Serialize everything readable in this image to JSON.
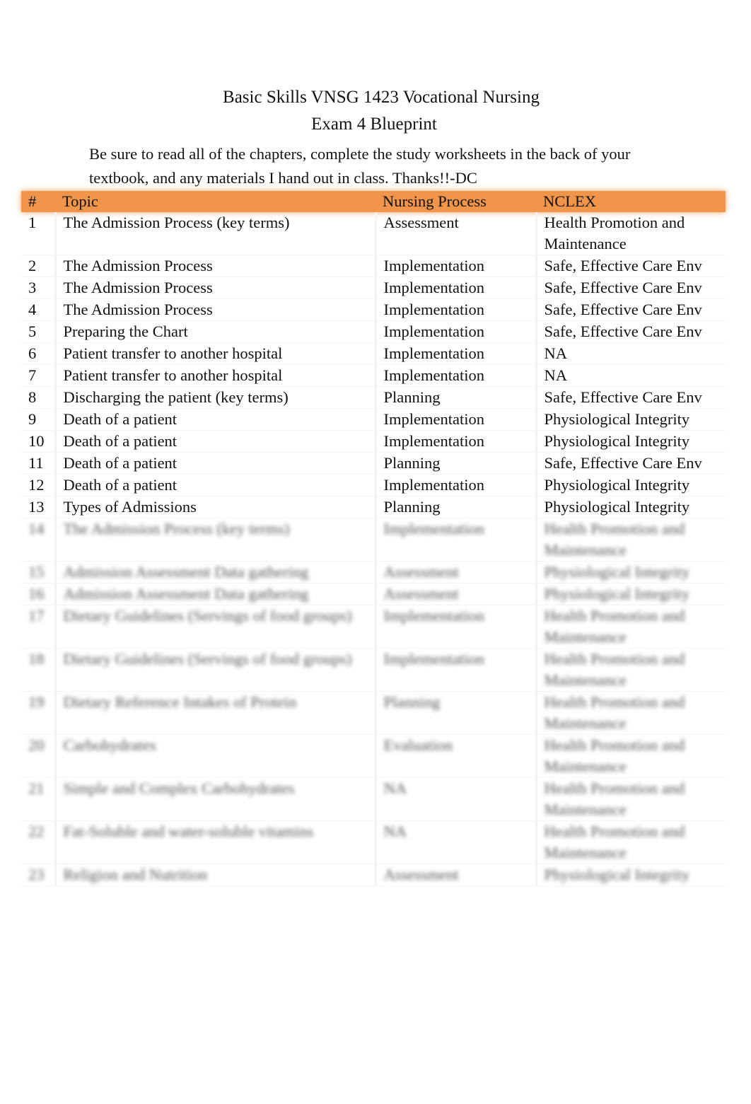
{
  "header": {
    "title_line1": "Basic Skills VNSG 1423 Vocational Nursing",
    "title_line2": "Exam 4 Blueprint",
    "intro": "Be sure to read all of the chapters, complete the study worksheets in the back of your textbook, and any materials I hand out in class. Thanks!!-DC"
  },
  "colors": {
    "header_row": "#f0954a"
  },
  "table": {
    "columns": [
      "#",
      "Topic",
      "Nursing Process",
      "NCLEX"
    ],
    "rows": [
      [
        "1",
        "The Admission Process (key terms)",
        "Assessment",
        "Health Promotion and Maintenance"
      ],
      [
        "2",
        "The Admission Process",
        "Implementation",
        "Safe, Effective Care Env"
      ],
      [
        "3",
        "The Admission Process",
        "Implementation",
        "Safe, Effective Care Env"
      ],
      [
        "4",
        "The Admission Process",
        "Implementation",
        "Safe, Effective Care Env"
      ],
      [
        "5",
        "Preparing the Chart",
        "Implementation",
        "Safe, Effective Care Env"
      ],
      [
        "6",
        "Patient transfer to another hospital",
        "Implementation",
        "NA"
      ],
      [
        "7",
        "Patient transfer to another hospital",
        "Implementation",
        "NA"
      ],
      [
        "8",
        "Discharging the patient (key terms)",
        "Planning",
        "Safe, Effective Care Env"
      ],
      [
        "9",
        "Death of a patient",
        "Implementation",
        "Physiological Integrity"
      ],
      [
        "10",
        "Death of a patient",
        "Implementation",
        "Physiological Integrity"
      ],
      [
        "11",
        "Death of a patient",
        "Planning",
        "Safe, Effective Care Env"
      ],
      [
        "12",
        "Death of a patient",
        "Implementation",
        "Physiological Integrity"
      ],
      [
        "13",
        "Types of Admissions",
        "Planning",
        "Physiological Integrity"
      ]
    ],
    "blurred_rows": [
      [
        "14",
        "The Admission Process (key terms)",
        "Implementation",
        "Health Promotion and Maintenance"
      ],
      [
        "15",
        "Admission Assessment Data gathering",
        "Assessment",
        "Physiological Integrity"
      ],
      [
        "16",
        "Admission Assessment Data gathering",
        "Assessment",
        "Physiological Integrity"
      ],
      [
        "17",
        "Dietary Guidelines (Servings of food groups)",
        "Implementation",
        "Health Promotion and Maintenance"
      ],
      [
        "18",
        "Dietary Guidelines (Servings of food groups)",
        "Implementation",
        "Health Promotion and Maintenance"
      ],
      [
        "19",
        "Dietary Reference Intakes of Protein",
        "Planning",
        "Health Promotion and Maintenance"
      ],
      [
        "20",
        "Carbohydrates",
        "Evaluation",
        "Health Promotion and Maintenance"
      ],
      [
        "21",
        "Simple and Complex Carbohydrates",
        "NA",
        "Health Promotion and Maintenance"
      ],
      [
        "22",
        "Fat-Soluble and water-soluble vitamins",
        "NA",
        "Health Promotion and Maintenance"
      ],
      [
        "23",
        "Religion and Nutrition",
        "Assessment",
        "Physiological Integrity"
      ]
    ]
  }
}
